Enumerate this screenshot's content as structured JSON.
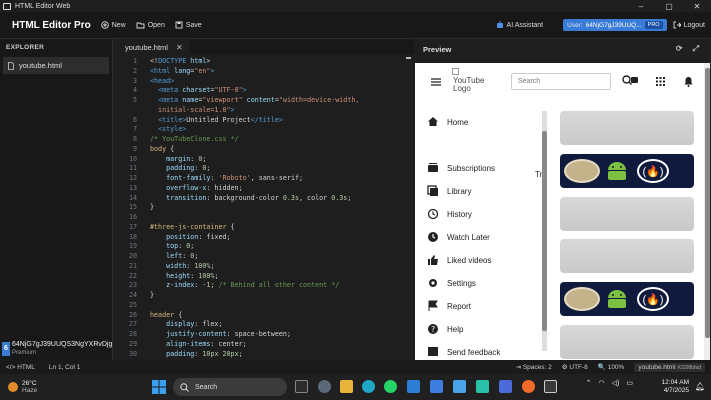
{
  "window": {
    "title": "HTML Editor Web",
    "controls": [
      "minimize-icon",
      "maximize-icon",
      "close-icon"
    ]
  },
  "toolbar": {
    "brand": "HTML Editor Pro",
    "new_label": "New",
    "open_label": "Open",
    "save_label": "Save",
    "ai_label": "AI Assistant",
    "user_prefix": "User:",
    "user_id": "64NjG7gJ39UUQ...",
    "pro_badge": "PRO",
    "logout_label": "Logout"
  },
  "sidebar": {
    "title": "EXPLORER",
    "files": [
      {
        "name": "youtube.html"
      }
    ],
    "user": {
      "avatar_letter": "6",
      "name": "64NjG7gJ39UUQS3NgYXRvDjg",
      "plan": "Premium"
    }
  },
  "editor": {
    "tab": "youtube.html",
    "lines": [
      {
        "n": "1",
        "html": "<span class='pu'>&lt;!</span><span class='tg'>DOCTYPE</span> <span class='at'>html</span><span class='pu'>&gt;</span>"
      },
      {
        "n": "2",
        "html": "<span class='tg'>&lt;html</span> <span class='at'>lang</span>=<span class='st'>\"en\"</span><span class='tg'>&gt;</span>"
      },
      {
        "n": "3",
        "html": "<span class='tg'>&lt;head&gt;</span>"
      },
      {
        "n": "4",
        "html": "  <span class='tg'>&lt;meta</span> <span class='at'>charset</span>=<span class='st'>\"UTF-8\"</span><span class='tg'>&gt;</span>"
      },
      {
        "n": "5",
        "html": "  <span class='tg'>&lt;meta</span> <span class='at'>name</span>=<span class='st'>\"viewport\"</span> <span class='at'>content</span>=<span class='st'>\"width=device-width,</span>"
      },
      {
        "n": "",
        "html": "<span class='st'>  initial-scale=1.0\"</span><span class='tg'>&gt;</span>"
      },
      {
        "n": "6",
        "html": "  <span class='tg'>&lt;title&gt;</span>Untitled Project<span class='tg'>&lt;/title&gt;</span>"
      },
      {
        "n": "7",
        "html": "  <span class='tg'>&lt;style&gt;</span>"
      },
      {
        "n": "8",
        "html": "<span class='cm'>/* YouTubeClone.css */</span>"
      },
      {
        "n": "9",
        "html": "<span class='sel'>body</span> {"
      },
      {
        "n": "10",
        "html": "    <span class='pr'>margin</span>: <span class='nm'>0</span>;"
      },
      {
        "n": "11",
        "html": "    <span class='pr'>padding</span>: <span class='nm'>0</span>;"
      },
      {
        "n": "12",
        "html": "    <span class='pr'>font-family</span>: <span class='st'>'Roboto'</span>, sans-serif;"
      },
      {
        "n": "13",
        "html": "    <span class='pr'>overflow-x</span>: hidden;"
      },
      {
        "n": "14",
        "html": "    <span class='pr'>transition</span>: background-color <span class='nm'>0.3s</span>, color <span class='nm'>0.3s</span>;"
      },
      {
        "n": "15",
        "html": "}"
      },
      {
        "n": "16",
        "html": ""
      },
      {
        "n": "17",
        "html": "<span class='sel'>#three-js-container</span> {"
      },
      {
        "n": "18",
        "html": "    <span class='pr'>position</span>: fixed;"
      },
      {
        "n": "19",
        "html": "    <span class='pr'>top</span>: <span class='nm'>0</span>;"
      },
      {
        "n": "20",
        "html": "    <span class='pr'>left</span>: <span class='nm'>0</span>;"
      },
      {
        "n": "21",
        "html": "    <span class='pr'>width</span>: <span class='nm'>100%</span>;"
      },
      {
        "n": "22",
        "html": "    <span class='pr'>height</span>: <span class='nm'>100%</span>;"
      },
      {
        "n": "23",
        "html": "    <span class='pr'>z-index</span>: <span class='nm'>-1</span>; <span class='cm'>/* Behind all other content */</span>"
      },
      {
        "n": "24",
        "html": "}"
      },
      {
        "n": "25",
        "html": ""
      },
      {
        "n": "26",
        "html": "<span class='sel'>header</span> {"
      },
      {
        "n": "27",
        "html": "    <span class='pr'>display</span>: flex;"
      },
      {
        "n": "28",
        "html": "    <span class='pr'>justify-content</span>: space-between;"
      },
      {
        "n": "29",
        "html": "    <span class='pr'>align-items</span>: center;"
      },
      {
        "n": "30",
        "html": "    <span class='pr'>padding</span>: <span class='nm'>10px 20px</span>;"
      }
    ]
  },
  "preview": {
    "title": "Preview",
    "logo_text": "YouTube Logo",
    "search_placeholder": "Search",
    "nav": [
      "Home",
      "Subscriptions",
      "Library",
      "History",
      "Watch Later",
      "Liked videos",
      "Settings",
      "Report",
      "Help",
      "Send feedback"
    ],
    "fragment": "Tr"
  },
  "status": {
    "lang": "HTML",
    "position": "Ln 1, Col 1",
    "spaces": "Spaces: 2",
    "encoding": "UTF-8",
    "zoom": "100%",
    "file": "youtube.html",
    "hash": "#2298bfad"
  },
  "taskbar": {
    "temp": "26°C",
    "weather": "Haze",
    "search_label": "Search",
    "time": "12:04 AM",
    "date": "4/7/2025"
  }
}
